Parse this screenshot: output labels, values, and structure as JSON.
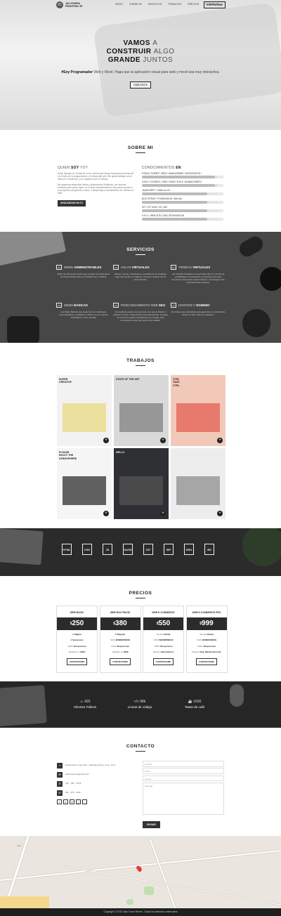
{
  "nav": {
    "logo_mark": "JC",
    "logo_line1": "JULI RIVERA",
    "logo_line2": "FRONTEND JR",
    "links": [
      "INICIO",
      "SOBRE MI",
      "SERVICIOS",
      "TRABAJOS",
      "PRECIOS",
      "CONTACTO"
    ],
    "cta": "CONTRATAME"
  },
  "hero": {
    "line1_bold": "VAMOS",
    "line1_light": "A",
    "line2_bold": "CONSTRUIR",
    "line2_light": "ALGO",
    "line3_bold": "GRANDE",
    "line3_light": "JUNTOS",
    "sub_bold": "#Soy Programador",
    "sub": "Web y Movil. Haga que la aplicación visual para web y movil sea muy interactiva.",
    "button": "HÁBLEMOS"
  },
  "about": {
    "title": "SOBRE MI",
    "left_heading_pre": "QUIEN",
    "left_heading_bold": "SOY",
    "left_heading_post": "YO?",
    "p1": "Estoy ubicado en Ciudad de Lima. Siendo que tengo experiencia profesional en el área de la programación y el desarrollo web. Me gusta trabajar con la última en Tendencia, y me capacito todo el Tiempo.",
    "p2": "Me apasiona desarrollar Webs y Aplicaciones Sintéticas, con buenas prácticas para poder darle un correcto mantenimiento y las pueda escalar a un proyecto más grande a futuro. Trabajo bajo el pensamiento de \"Menos es Mas\"",
    "button": "DESCARGAR MI CV",
    "right_heading_pre": "CONOCIMIENTOS",
    "right_heading_bold": "EN",
    "skills": [
      {
        "label": "HTML5 / DOMEIT / BEM / HANDLEBARS / MICRODATOS / ",
        "pct": "90%",
        "value": 0.9
      },
      {
        "label": "CSS3 / FLEXBOX / GRID / SASS / B.W.Z / ANIMACIONES / ",
        "pct": "90%",
        "value": 0.9
      },
      {
        "label": "JAVASCRIPT / VANILLA JS / ",
        "pct": "80%",
        "value": 0.8
      },
      {
        "label": "BOOTSTRAP / FOUNDATION / BULMA",
        "pct": "80%",
        "value": 0.8
      },
      {
        "label": "GIT / GIT HUB / GIT LAB",
        "pct": "80%",
        "value": 0.8
      },
      {
        "label": "S.E.O. / WEB SITE LOAD OPTIMIZATION",
        "pct": "80%",
        "value": 0.8
      }
    ]
  },
  "services": {
    "title": "SERVICIOS",
    "items": [
      {
        "icon": "▭",
        "pre": "WEBS",
        "bold": "ADMINISTRABLES",
        "desc": "Webs de última generación que cumplen los estándares de Diseño Responsive en Smartphones y Tablets."
      },
      {
        "icon": "▭",
        "pre": "AULAS",
        "bold": "VIRTUALES",
        "desc": "Clases, Cursos y Seminarios a estudiantes de cualquier lugar del mundo en cualquier momento, durante las 24 Horas del Día."
      },
      {
        "icon": "▭",
        "pre": "TIENDAS",
        "bold": "VIRTUALES",
        "desc": "Las Tiendas Virtuales te comenzarán abrir un mundo de posibilidades a profesional o empresario que esta buscando nuevamente captar clientes y tecnologías web para fácilmente ingresos."
      },
      {
        "icon": "▭",
        "pre": "WEBS",
        "bold": "BÁSICAS",
        "desc": "Las Webs Básicas que desarrollo son totalmente personalizadas y validadas en W3C con las mejores estándares a nivel mundial."
      },
      {
        "icon": "▭",
        "pre": "POSICIONAMIENTO WEB",
        "bold": "SEO",
        "desc": "Una anidado experto de personas cree que el Diseño o publicar su Web o Página Web automáticamente, ocupará los primeros lugares del Buscador de Google, este pensamiento esta muy lejos de la realidad."
      },
      {
        "icon": "▭",
        "pre": "HOSTING Y",
        "bold": "DOMINIO",
        "desc": "El hosting este optimizado para garantizar un rendimiento eficaz con alto índice de visitantes."
      }
    ]
  },
  "works": {
    "title": "TRABAJOS",
    "items": [
      {
        "title": "SUPER\nCREATIVE",
        "bg": "#f2f2f2",
        "accent": "#e8d87a"
      },
      {
        "title": "STATE OF THE ART",
        "bg": "#d9d9d9",
        "accent": "#7a7a7a"
      },
      {
        "title": "CTRL\nTAKE\nCTRL",
        "bg": "#f2c9b8",
        "accent": "#e2584c"
      },
      {
        "title": "PLEASE\nENJOY THE\nATMOSPHERE",
        "bg": "#f5f5f5",
        "accent": "#222"
      },
      {
        "title": "HELLO",
        "bg": "#2f3034",
        "accent": "#555"
      },
      {
        "title": "",
        "bg": "#ededed",
        "accent": "#888"
      }
    ],
    "plus": "+"
  },
  "tech": {
    "icons": [
      "HTML",
      "CSS",
      "JS",
      "SASS",
      "GIT",
      "WP",
      "DRU",
      "BS"
    ]
  },
  "pricing": {
    "title": "PRECIOS",
    "plans": [
      {
        "name": "WEB BASIC",
        "currency": "$",
        "price": "250",
        "features": [
          [
            "",
            "1 Página"
          ],
          [
            "",
            "1 Secciones"
          ],
          [
            "100% ",
            "Responsive"
          ],
          [
            "Validado en ",
            "W3C"
          ]
        ],
        "button": "CONTRATAME"
      },
      {
        "name": "WEB MULTIPAGE",
        "currency": "$",
        "price": "380",
        "features": [
          [
            "",
            "1 Páginas"
          ],
          [
            "CMS ",
            "WORDPRESS"
          ],
          [
            "100% ",
            "Responsive"
          ],
          [
            "Validado en ",
            "W3C"
          ]
        ],
        "button": "CONTRATAME"
      },
      {
        "name": "WEB E-COMMERCE",
        "currency": "$",
        "price": "550",
        "features": [
          [
            "Tienda ",
            "Virtual"
          ],
          [
            "CMS ",
            "WORDPRESS"
          ],
          [
            "100% ",
            "Responsive"
          ],
          [
            "Plugins ",
            "Informativos"
          ]
        ],
        "button": "CONTRATAME"
      },
      {
        "name": "WEB E-COMMERCE PRO",
        "currency": "$",
        "price": "999",
        "features": [
          [
            "Tienda ",
            "Virtual"
          ],
          [
            "CMS ",
            "WORDPRESS"
          ],
          [
            "100% ",
            "Responsive"
          ],
          [
            "Plugins ",
            "Visa, Mastercard, Etc"
          ]
        ],
        "button": "CONTRATAME"
      }
    ]
  },
  "stats": [
    {
      "icon": "☺",
      "num": "420",
      "label": "Clientes Felices"
    },
    {
      "icon": "</>",
      "num": "98k",
      "label": "Lineas de código"
    },
    {
      "icon": "☕",
      "num": "1500",
      "label": "Tasas de café"
    }
  ],
  "contact": {
    "title": "CONTACTO",
    "items": [
      {
        "icon": "⌂",
        "text": "Urbanización Jose (95) - Villa Esperanza, Lima - Peru"
      },
      {
        "icon": "✉",
        "text": "juliriveraperu@gmail.com"
      },
      {
        "icon": "✆",
        "text": "(01) - 587 - 2578"
      },
      {
        "icon": "☏",
        "text": "011 - 576 - 2536"
      }
    ],
    "socials": [
      "f",
      "◎",
      "in",
      "◯",
      "◌"
    ],
    "fields": [
      "Nombre",
      "Email",
      "Asunto",
      "Mensaje"
    ],
    "button": "ENVIAR"
  },
  "map": {
    "label": "UPC"
  },
  "footer": {
    "text": "Copyright © 2019 Julio Cesar Rivera - Todos los derechos reservados"
  }
}
